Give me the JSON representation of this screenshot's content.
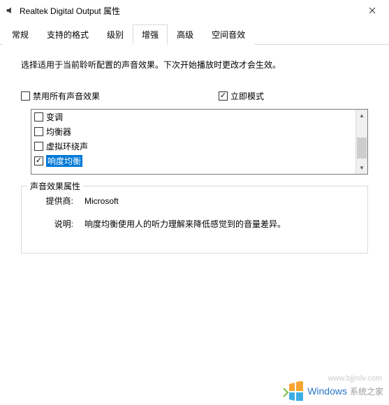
{
  "window": {
    "title": "Realtek Digital Output 属性"
  },
  "tabs": [
    {
      "label": "常规",
      "active": false
    },
    {
      "label": "支持的格式",
      "active": false
    },
    {
      "label": "级别",
      "active": false
    },
    {
      "label": "增强",
      "active": true
    },
    {
      "label": "高级",
      "active": false
    },
    {
      "label": "空间音效",
      "active": false
    }
  ],
  "description": "选择适用于当前聆听配置的声音效果。下次开始播放时更改才会生效。",
  "topChecks": {
    "disableAll": {
      "label": "禁用所有声音效果",
      "checked": false
    },
    "immediate": {
      "label": "立即模式",
      "checked": true
    }
  },
  "effects": [
    {
      "label": "变调",
      "checked": false,
      "selected": false
    },
    {
      "label": "均衡器",
      "checked": false,
      "selected": false
    },
    {
      "label": "虚拟环绕声",
      "checked": false,
      "selected": false
    },
    {
      "label": "响度均衡",
      "checked": true,
      "selected": true
    }
  ],
  "properties": {
    "groupTitle": "声音效果属性",
    "providerLabel": "提供商:",
    "providerValue": "Microsoft",
    "descLabel": "说明:",
    "descValue": "响度均衡使用人的听力理解来降低感觉到的音量差异。"
  },
  "watermark": {
    "url": "www.bjjmlv.com",
    "brand1": "Windows",
    "brand2": "系统之家"
  }
}
